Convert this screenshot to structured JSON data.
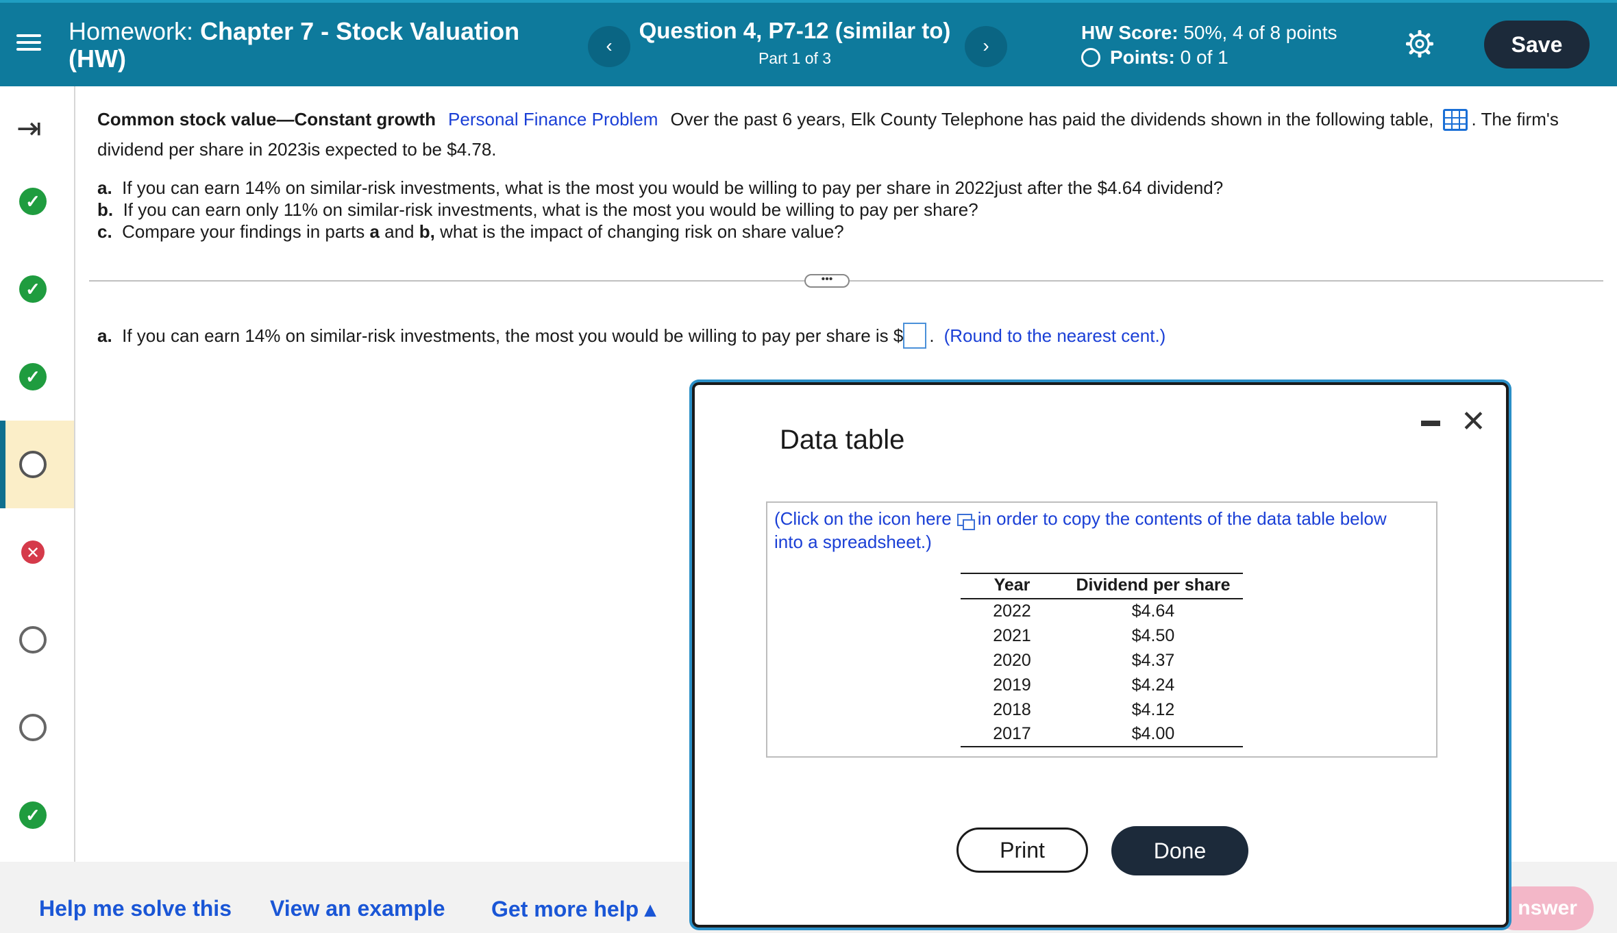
{
  "header": {
    "hw_prefix": "Homework:",
    "hw_title": "Chapter 7 - Stock Valuation",
    "hw_title_line2": "(HW)",
    "question_title": "Question 4, P7-12 (similar to)",
    "question_part": "Part 1 of 3",
    "score_label": "HW Score:",
    "score_value": "50%, 4 of 8 points",
    "points_label": "Points:",
    "points_value": "0 of 1",
    "prev_icon": "‹",
    "next_icon": "›",
    "save_label": "Save"
  },
  "sidebar": {
    "items": [
      {
        "status": "correct"
      },
      {
        "status": "correct"
      },
      {
        "status": "correct"
      },
      {
        "status": "current"
      },
      {
        "status": "incorrect"
      },
      {
        "status": "unanswered"
      },
      {
        "status": "unanswered"
      },
      {
        "status": "correct"
      }
    ]
  },
  "question": {
    "topic": "Common stock value—Constant growth",
    "tag": "Personal Finance Problem",
    "text1": "Over the past 6 years, Elk County Telephone has paid the dividends shown in the following table,",
    "text2": ". The firm's dividend per share in 2023is expected to be $4.78.",
    "part_a_label": "a.",
    "part_a": "If you can earn 14% on similar-risk investments, what is the most you would be willing to pay per share in 2022just after the $4.64 dividend?",
    "part_b_label": "b.",
    "part_b": "If you can earn only 11% on similar-risk investments, what is the most you would be willing to pay per share?",
    "part_c_label": "c.",
    "part_c_1": "Compare your findings in parts",
    "part_c_a": "a",
    "part_c_and": "and",
    "part_c_b": "b,",
    "part_c_2": "what is the impact of changing risk on share value?"
  },
  "answer": {
    "label": "a.",
    "text": "If you can earn 14% on similar-risk investments, the most you would be willing to pay per share is $",
    "period": ".",
    "hint": "(Round to the nearest cent.)",
    "value": ""
  },
  "bottom": {
    "help_me": "Help me solve this",
    "example": "View an example",
    "more_help": "Get more help ▴",
    "check_answer": "nswer"
  },
  "modal": {
    "title": "Data table",
    "copy_text_1": "(Click on the icon here",
    "copy_text_2": "in order to copy the contents of the data table below into a spreadsheet.)",
    "columns": [
      "Year",
      "Dividend per share"
    ],
    "rows": [
      [
        "2022",
        "$4.64"
      ],
      [
        "2021",
        "$4.50"
      ],
      [
        "2020",
        "$4.37"
      ],
      [
        "2019",
        "$4.24"
      ],
      [
        "2018",
        "$4.12"
      ],
      [
        "2017",
        "$4.00"
      ]
    ],
    "print_label": "Print",
    "done_label": "Done"
  }
}
